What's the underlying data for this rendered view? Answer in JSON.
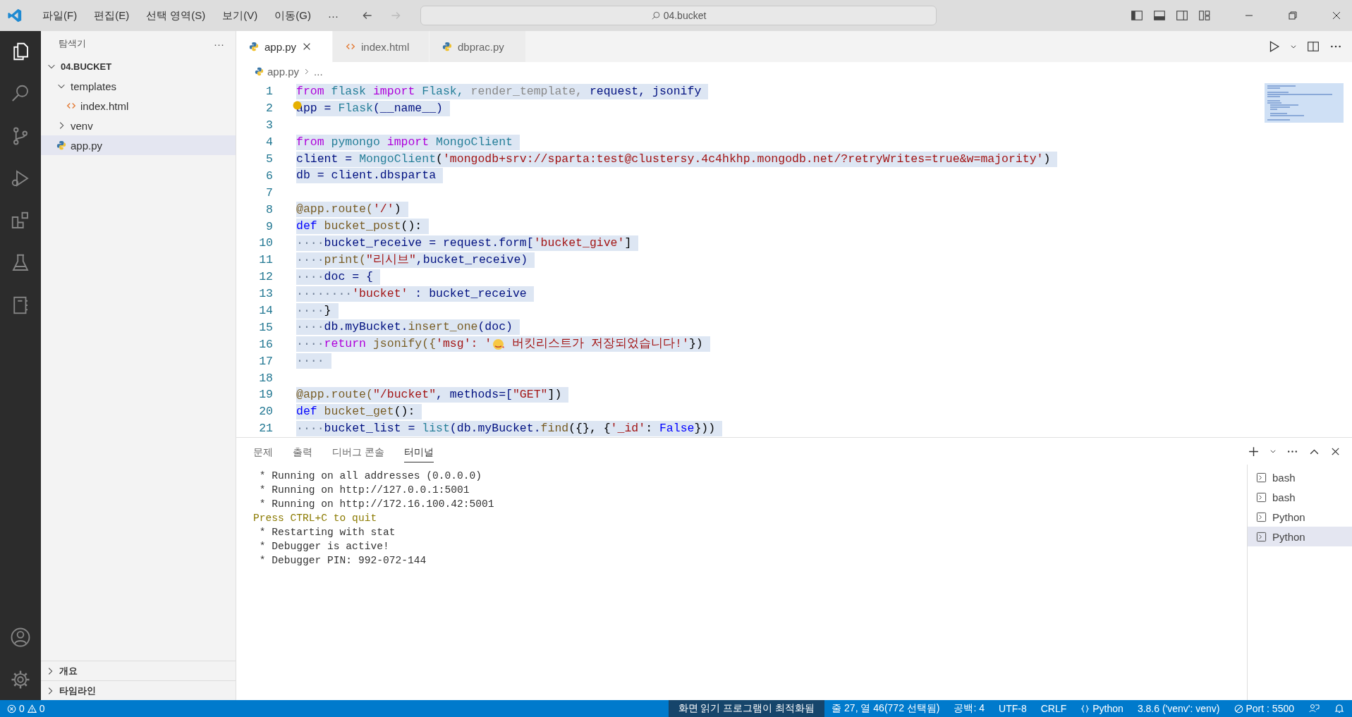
{
  "title_bar": {
    "menus": [
      "파일(F)",
      "편집(E)",
      "선택 영역(S)",
      "보기(V)",
      "이동(G)",
      "···"
    ],
    "search": {
      "value": "04.bucket"
    }
  },
  "sidebar": {
    "title": "탐색기",
    "more": "···",
    "tree": [
      {
        "label": "04.BUCKET",
        "kind": "root",
        "expanded": true,
        "selected": false,
        "children": [
          {
            "label": "templates",
            "kind": "folder",
            "expanded": true,
            "selected": false,
            "children": [
              {
                "label": "index.html",
                "kind": "html",
                "selected": false
              }
            ]
          },
          {
            "label": "venv",
            "kind": "folder",
            "expanded": false,
            "selected": false
          },
          {
            "label": "app.py",
            "kind": "py",
            "selected": true
          }
        ]
      }
    ],
    "sections": [
      {
        "label": "개요",
        "expanded": false
      },
      {
        "label": "타임라인",
        "expanded": false
      }
    ]
  },
  "tabs": [
    {
      "label": "app.py",
      "kind": "py",
      "selected": true
    },
    {
      "label": "index.html",
      "kind": "html",
      "selected": false
    },
    {
      "label": "dbprac.py",
      "kind": "py",
      "selected": false
    }
  ],
  "breadcrumb": [
    "app.py",
    "..."
  ],
  "code": [
    {
      "n": "1",
      "tokens": [
        {
          "text": "from ",
          "kind": "keyword"
        },
        {
          "text": "flask ",
          "kind": "class"
        },
        {
          "text": "import ",
          "kind": "keyword"
        },
        {
          "text": "Flask,",
          "kind": "class"
        },
        {
          "text": " render_template,",
          "kind": "unused"
        },
        {
          "text": " request, jsonify",
          "kind": "variable"
        }
      ]
    },
    {
      "n": "2",
      "tokens": [
        {
          "text": "app = ",
          "kind": "variable"
        },
        {
          "text": "Flask",
          "kind": "class"
        },
        {
          "text": "(__name__)",
          "kind": "variable"
        }
      ]
    },
    {
      "n": "3"
    },
    {
      "n": "4",
      "tokens": [
        {
          "text": "from ",
          "kind": "keyword"
        },
        {
          "text": "pymongo ",
          "kind": "class"
        },
        {
          "text": "import ",
          "kind": "keyword"
        },
        {
          "text": "MongoClient",
          "kind": "class"
        }
      ]
    },
    {
      "n": "5",
      "tokens": [
        {
          "text": "client = ",
          "kind": "variable"
        },
        {
          "text": "MongoClient",
          "kind": "class"
        },
        {
          "text": "(",
          "kind": "plain"
        },
        {
          "text": "'mongodb+srv://sparta:test@clustersy.4c4hkhp.mongodb.net/?retryWrites=true&w=majority'",
          "kind": "string"
        },
        {
          "text": ")",
          "kind": "plain"
        }
      ]
    },
    {
      "n": "6",
      "tokens": [
        {
          "text": "db = client.dbsparta",
          "kind": "variable"
        }
      ]
    },
    {
      "n": "7"
    },
    {
      "n": "8",
      "tokens": [
        {
          "text": "@app.route(",
          "kind": "function"
        },
        {
          "text": "'/'",
          "kind": "string"
        },
        {
          "text": ")",
          "kind": "plain"
        }
      ]
    },
    {
      "n": "9",
      "tokens": [
        {
          "text": "def ",
          "kind": "def"
        },
        {
          "text": "bucket_post",
          "kind": "function"
        },
        {
          "text": "():",
          "kind": "plain"
        }
      ]
    },
    {
      "n": "10",
      "tokens": [
        {
          "text": "····",
          "kind": "whitespace"
        },
        {
          "text": "bucket_receive = request.form[",
          "kind": "variable"
        },
        {
          "text": "'bucket_give'",
          "kind": "string"
        },
        {
          "text": "]",
          "kind": "plain"
        }
      ]
    },
    {
      "n": "11",
      "tokens": [
        {
          "text": "····",
          "kind": "whitespace"
        },
        {
          "text": "print(",
          "kind": "function"
        },
        {
          "text": "\"리시브\"",
          "kind": "string"
        },
        {
          "text": ",bucket_receive)",
          "kind": "variable"
        }
      ]
    },
    {
      "n": "12",
      "tokens": [
        {
          "text": "····",
          "kind": "whitespace"
        },
        {
          "text": "doc = {",
          "kind": "variable"
        }
      ]
    },
    {
      "n": "13",
      "tokens": [
        {
          "text": "········",
          "kind": "whitespace"
        },
        {
          "text": "'bucket'",
          "kind": "string"
        },
        {
          "text": " : bucket_receive",
          "kind": "variable"
        }
      ]
    },
    {
      "n": "14",
      "tokens": [
        {
          "text": "····",
          "kind": "whitespace"
        },
        {
          "text": "}",
          "kind": "plain"
        }
      ]
    },
    {
      "n": "15",
      "tokens": [
        {
          "text": "····",
          "kind": "whitespace"
        },
        {
          "text": "db.myBucket.",
          "kind": "variable"
        },
        {
          "text": "insert_one",
          "kind": "function"
        },
        {
          "text": "(doc)",
          "kind": "variable"
        }
      ]
    },
    {
      "n": "16",
      "tokens": [
        {
          "text": "····",
          "kind": "whitespace"
        },
        {
          "text": "return ",
          "kind": "keyword"
        },
        {
          "text": "jsonify({",
          "kind": "function"
        },
        {
          "text": "'msg': '",
          "kind": "string"
        },
        {
          "kind": "emoji"
        },
        {
          "text": " 버킷리스트가 저장되었습니다!'",
          "kind": "string"
        },
        {
          "text": "})",
          "kind": "plain"
        }
      ]
    },
    {
      "n": "17",
      "tokens": [
        {
          "text": "····",
          "kind": "whitespace"
        }
      ]
    },
    {
      "n": "18"
    },
    {
      "n": "19",
      "tokens": [
        {
          "text": "@app.route(",
          "kind": "function"
        },
        {
          "text": "\"/bucket\"",
          "kind": "string"
        },
        {
          "text": ", methods=[",
          "kind": "variable"
        },
        {
          "text": "\"GET\"",
          "kind": "string"
        },
        {
          "text": "])",
          "kind": "plain"
        }
      ]
    },
    {
      "n": "20",
      "tokens": [
        {
          "text": "def ",
          "kind": "def"
        },
        {
          "text": "bucket_get",
          "kind": "function"
        },
        {
          "text": "():",
          "kind": "plain"
        }
      ]
    },
    {
      "n": "21",
      "tokens": [
        {
          "text": "····",
          "kind": "whitespace"
        },
        {
          "text": "bucket_list = ",
          "kind": "variable"
        },
        {
          "text": "list",
          "kind": "class"
        },
        {
          "text": "(db.myBucket.",
          "kind": "variable"
        },
        {
          "text": "find",
          "kind": "function"
        },
        {
          "text": "({}, {",
          "kind": "plain"
        },
        {
          "text": "'_id'",
          "kind": "string"
        },
        {
          "text": ": ",
          "kind": "plain"
        },
        {
          "text": "False",
          "kind": "def"
        },
        {
          "text": "}))",
          "kind": "plain"
        }
      ]
    }
  ],
  "panel": {
    "tabs": [
      {
        "label": "문제",
        "selected": false
      },
      {
        "label": "출력",
        "selected": false
      },
      {
        "label": "디버그 콘솔",
        "selected": false
      },
      {
        "label": "터미널",
        "selected": true
      }
    ],
    "terminal": [
      {
        "text": " * Running on all addresses (0.0.0.0)",
        "kind": "plain"
      },
      {
        "text": " * Running on http://127.0.0.1:5001",
        "kind": "plain"
      },
      {
        "text": " * Running on http://172.16.100.42:5001",
        "kind": "plain"
      },
      {
        "text": "Press CTRL+C to quit",
        "kind": "warn"
      },
      {
        "text": " * Restarting with stat",
        "kind": "plain"
      },
      {
        "text": " * Debugger is active!",
        "kind": "plain"
      },
      {
        "text": " * Debugger PIN: 992-072-144",
        "kind": "plain"
      }
    ],
    "sessions": [
      {
        "label": "bash",
        "selected": false
      },
      {
        "label": "bash",
        "selected": false
      },
      {
        "label": "Python",
        "selected": false
      },
      {
        "label": "Python",
        "selected": true
      }
    ]
  },
  "status_bar": {
    "errors": "0",
    "warnings": "0",
    "screen_reader": "화면 읽기 프로그램이 최적화됨",
    "position": "줄 27, 열 46(772 선택됨)",
    "spaces": "공백: 4",
    "encoding": "UTF-8",
    "eol": "CRLF",
    "language": "Python",
    "interpreter": "3.8.6 ('venv': venv)",
    "port": "Port : 5500"
  }
}
